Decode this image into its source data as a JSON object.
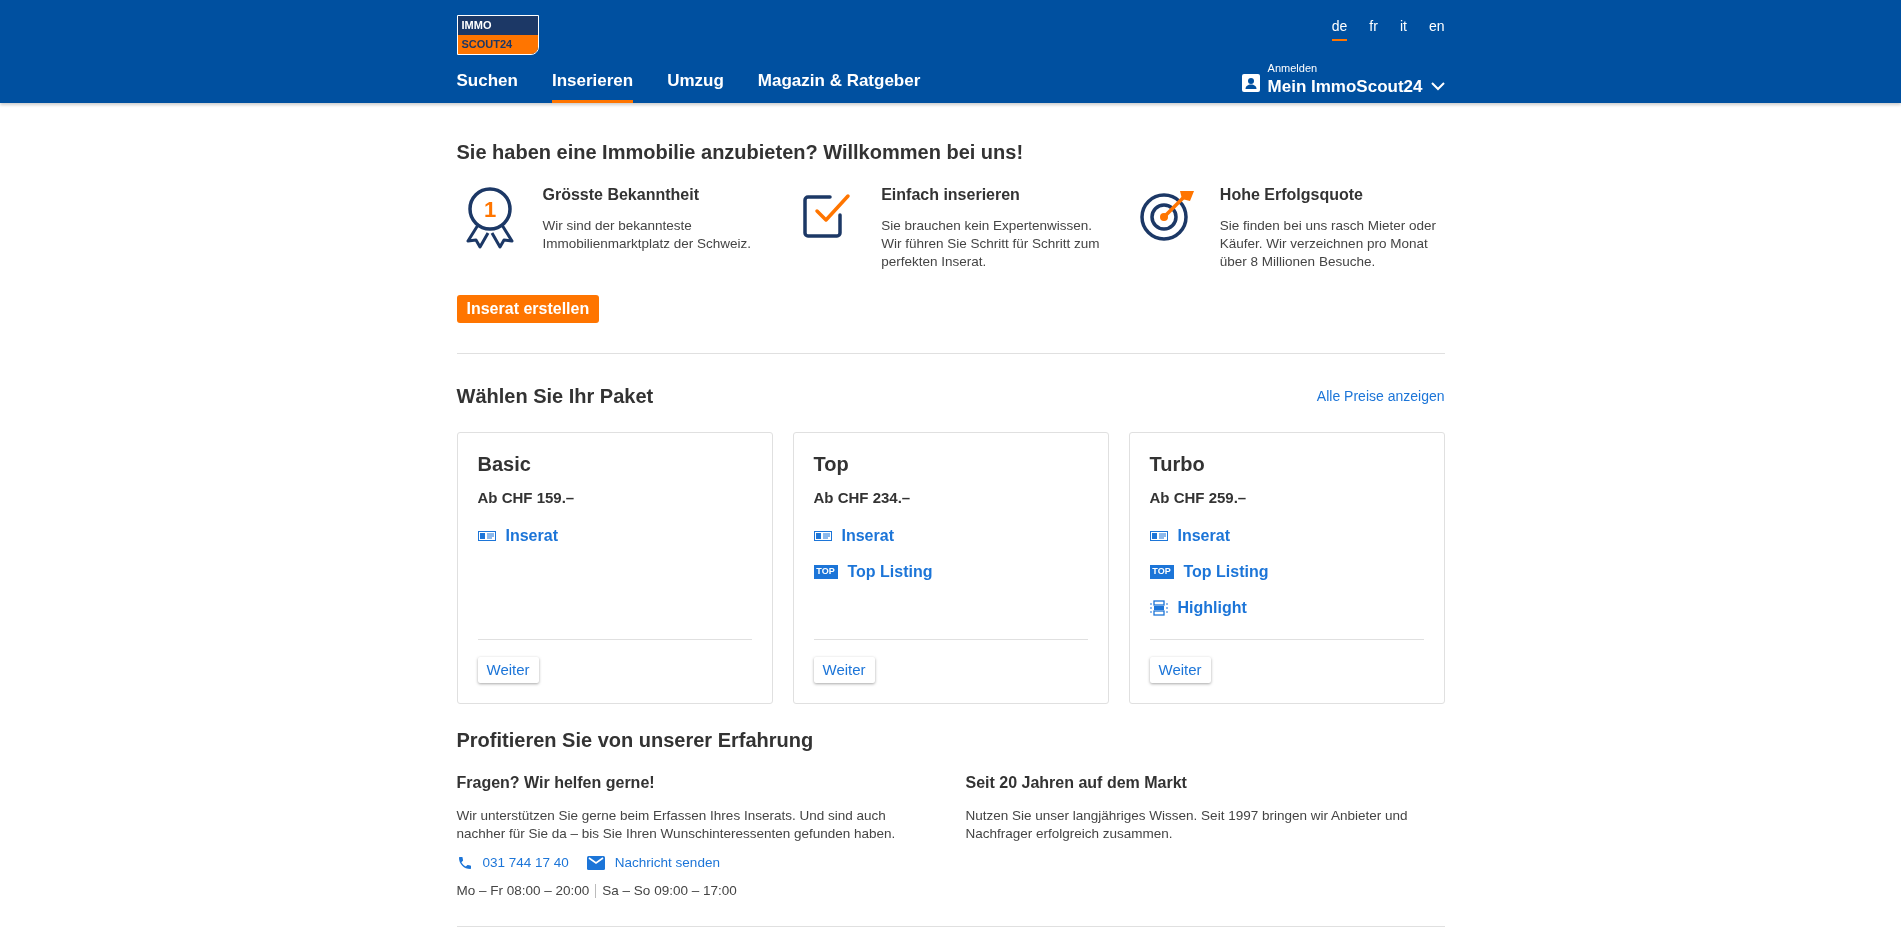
{
  "header": {
    "logo": {
      "top": "IMMO",
      "bottom": "SCOUT24"
    },
    "languages": [
      {
        "label": "de",
        "selected": true
      },
      {
        "label": "fr",
        "selected": false
      },
      {
        "label": "it",
        "selected": false
      },
      {
        "label": "en",
        "selected": false
      }
    ],
    "nav": [
      {
        "label": "Suchen",
        "selected": false
      },
      {
        "label": "Inserieren",
        "selected": true
      },
      {
        "label": "Umzug",
        "selected": false
      },
      {
        "label": "Magazin & Ratgeber",
        "selected": false
      }
    ],
    "account": {
      "hint": "Anmelden",
      "label": "Mein ImmoScout24"
    }
  },
  "intro": {
    "title": "Sie haben eine Immobilie anzubieten? Willkommen bei uns!",
    "features": [
      {
        "kind": "award",
        "icon_text": "1",
        "title": "Grösste Bekanntheit",
        "text": "Wir sind der bekannteste Immobilienmarktplatz der Schweiz."
      },
      {
        "kind": "check",
        "title": "Einfach inserieren",
        "text": "Sie brauchen kein Expertenwissen. Wir führen Sie Schritt für Schritt zum perfekten Inserat."
      },
      {
        "kind": "target",
        "title": "Hohe Erfolgsquote",
        "text": "Sie finden bei uns rasch Mieter oder Käufer. Wir verzeichnen pro Monat über 8 Millionen Besuche."
      }
    ],
    "button": "Inserat erstellen"
  },
  "packages": {
    "title": "Wählen Sie Ihr Paket",
    "link": "Alle Preise anzeigen",
    "cards": [
      {
        "name": "Basic",
        "price": "Ab CHF 159.–",
        "features": [
          {
            "kind": "listing",
            "label": "Inserat"
          }
        ],
        "button": "Weiter"
      },
      {
        "name": "Top",
        "price": "Ab CHF 234.–",
        "features": [
          {
            "kind": "listing",
            "label": "Inserat"
          },
          {
            "kind": "top",
            "label": "Top Listing",
            "icon_text": "TOP"
          }
        ],
        "button": "Weiter"
      },
      {
        "name": "Turbo",
        "price": "Ab CHF 259.–",
        "features": [
          {
            "kind": "listing",
            "label": "Inserat"
          },
          {
            "kind": "top",
            "label": "Top Listing",
            "icon_text": "TOP"
          },
          {
            "kind": "highlight",
            "label": "Highlight"
          }
        ],
        "button": "Weiter"
      }
    ]
  },
  "experience": {
    "title": "Profitieren Sie von unserer Erfahrung",
    "columns": [
      {
        "title": "Fragen? Wir helfen gerne!",
        "text": "Wir unterstützen Sie gerne beim Erfassen Ihres Inserats. Und sind auch nachher für Sie da – bis Sie Ihren Wunschinteressenten gefunden haben.",
        "phone": "031 744 17 40",
        "message": "Nachricht senden",
        "hours": [
          "Mo – Fr 08:00 – 20:00",
          "Sa – So 09:00 – 17:00"
        ]
      },
      {
        "title": "Seit 20 Jahren auf dem Markt",
        "text": "Nutzen Sie unser langjähriges Wissen. Seit 1997 bringen wir Anbieter und Nachfrager erfolgreich zusammen."
      }
    ]
  }
}
